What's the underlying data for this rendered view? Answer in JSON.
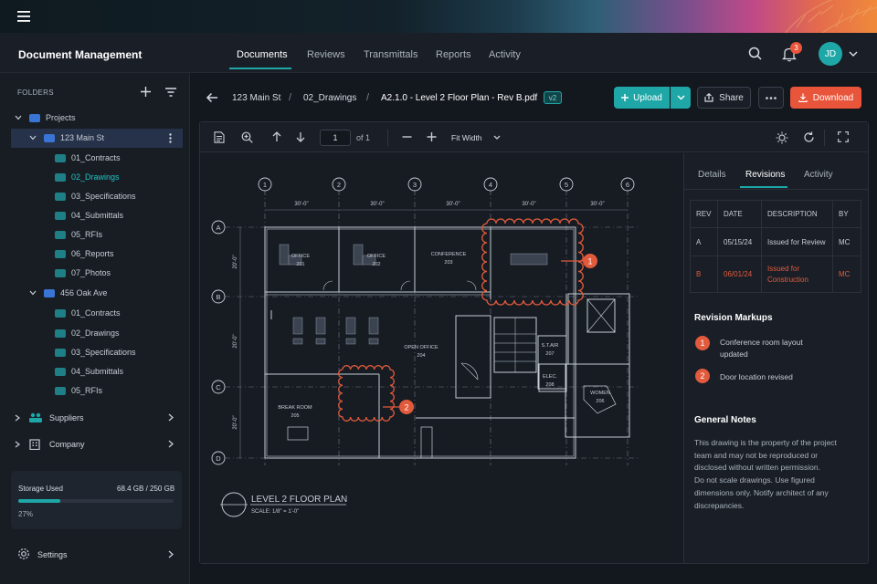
{
  "app": {
    "title": "Document Management"
  },
  "nav": {
    "tabs": [
      "Documents",
      "Reviews",
      "Transmittals",
      "Reports",
      "Activity"
    ],
    "active": "Documents",
    "notification_count": "3",
    "avatar_initials": "JD"
  },
  "sidebar": {
    "folders_label": "FOLDERS",
    "items": [
      {
        "label": "Projects",
        "level": 0
      },
      {
        "label": "123 Main St",
        "level": 1,
        "selected": true
      },
      {
        "label": "01_Contracts",
        "level": 2
      },
      {
        "label": "02_Drawings",
        "level": 2,
        "active": true
      },
      {
        "label": "03_Specifications",
        "level": 2
      },
      {
        "label": "04_Submittals",
        "level": 2
      },
      {
        "label": "05_RFIs",
        "level": 2
      },
      {
        "label": "06_Reports",
        "level": 2
      },
      {
        "label": "07_Photos",
        "level": 2
      },
      {
        "label": "456 Oak Ave",
        "level": 1
      },
      {
        "label": "01_Contracts",
        "level": 2
      },
      {
        "label": "02_Drawings",
        "level": 2
      },
      {
        "label": "03_Specifications",
        "level": 2
      },
      {
        "label": "04_Submittals",
        "level": 2
      },
      {
        "label": "05_RFIs",
        "level": 2
      }
    ],
    "suppliers_label": "Suppliers",
    "company_label": "Company",
    "storage": {
      "label": "Storage Used",
      "value": "68.4 GB / 250 GB",
      "percent_label": "27%",
      "fraction": 0.27
    },
    "settings_label": "Settings"
  },
  "breadcrumb": {
    "project": "123 Main St",
    "folder": "02_Drawings",
    "file": "A2.1.0 - Level 2 Floor Plan - Rev B.pdf",
    "version": "v2"
  },
  "actions": {
    "upload": "Upload",
    "share": "Share",
    "download": "Download"
  },
  "viewer": {
    "page": "1",
    "of_pages": "of 1",
    "zoom": "Fit Width"
  },
  "drawing": {
    "grid_columns": [
      "1",
      "2",
      "3",
      "4",
      "5",
      "6"
    ],
    "grid_rows": [
      "A",
      "B",
      "C",
      "D"
    ],
    "column_dims": [
      "30'-0\"",
      "30'-0\"",
      "30'-0\"",
      "30'-0\"",
      "30'-0\""
    ],
    "row_dims": [
      "20'-0\"",
      "20'-0\"",
      "20'-0\""
    ],
    "rooms": [
      {
        "name": "OFFICE",
        "number": "201"
      },
      {
        "name": "OFFICE",
        "number": "202"
      },
      {
        "name": "CONFERENCE",
        "number": "203"
      },
      {
        "name": "OPEN OFFICE",
        "number": "204"
      },
      {
        "name": "BREAK ROOM",
        "number": "205"
      },
      {
        "name": "S.T.AIR",
        "number": "207"
      },
      {
        "name": "ELEC.",
        "number": "208"
      },
      {
        "name": "WOMEN",
        "number": "206"
      }
    ],
    "title": "LEVEL 2 FLOOR PLAN",
    "scale": "SCALE: 1/8\" = 1'-0\"",
    "markers": [
      "1",
      "2"
    ]
  },
  "panel": {
    "tabs": [
      "Details",
      "Revisions",
      "Activity"
    ],
    "active_tab": "Revisions",
    "table": {
      "headers": [
        "REV",
        "DATE",
        "DESCRIPTION",
        "BY"
      ],
      "rows": [
        {
          "rev": "A",
          "date": "05/15/24",
          "desc1": "Issued for Review",
          "desc2": "",
          "by": "MC"
        },
        {
          "rev": "B",
          "date": "06/01/24",
          "desc1": "Issued for",
          "desc2": "Construction",
          "by": "MC"
        }
      ]
    },
    "markups_title": "Revision Markups",
    "markups": [
      {
        "num": "1",
        "line1": "Conference room layout",
        "line2": "updated"
      },
      {
        "num": "2",
        "line1": "Door location revised",
        "line2": ""
      }
    ],
    "notes_title": "General Notes",
    "notes_lines": [
      "This drawing is the property of the project",
      "team and may not be reproduced or",
      "disclosed without written permission.",
      "Do not scale drawings. Use figured",
      "dimensions only. Notify architect of any",
      "discrepancies."
    ]
  },
  "colors": {
    "accent": "#1fa7a8",
    "markup": "#e15a3c",
    "download": "#e8553a",
    "background": "#13171e"
  }
}
